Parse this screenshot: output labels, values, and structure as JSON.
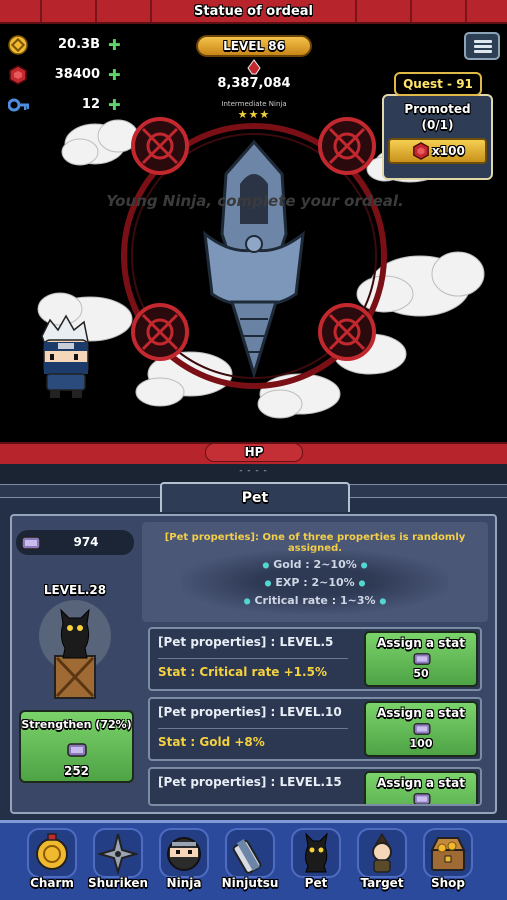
{
  "header": {
    "title": "Statue of ordeal"
  },
  "resources": [
    {
      "icon": "gold-coin-icon",
      "value": "20.3B"
    },
    {
      "icon": "red-gem-icon",
      "value": "38400"
    },
    {
      "icon": "key-icon",
      "value": "12"
    }
  ],
  "player": {
    "level": "LEVEL 86",
    "power": "8,387,084",
    "rank": "Intermediate Ninja",
    "stars": "★★★"
  },
  "quest": {
    "label": "Quest - 91",
    "name": "Promoted",
    "progress": "(0/1)",
    "reward": "x100"
  },
  "scene": {
    "message": "Young Ninja, complete your ordeal."
  },
  "hp": {
    "label": "HP",
    "value": "- - - -"
  },
  "pet_tab": {
    "label": "Pet"
  },
  "pet": {
    "feed_count": "974",
    "level": "LEVEL.28",
    "strengthen_label": "Strengthen (72%)",
    "strengthen_cost": "252",
    "strengthen_progress": 0.72
  },
  "properties_info": {
    "header": "[Pet properties]: One of three properties is randomly assigned.",
    "chances": [
      "Gold : 2~10%",
      "EXP : 2~10%",
      "Critical rate : 1~3%"
    ]
  },
  "property_rows": [
    {
      "title": "[Pet properties] : LEVEL.5",
      "stat": "Stat : Critical rate +1.5%",
      "button": "Assign a stat",
      "cost": "50"
    },
    {
      "title": "[Pet properties] : LEVEL.10",
      "stat": "Stat : Gold +8%",
      "button": "Assign a stat",
      "cost": "100"
    },
    {
      "title": "[Pet properties] : LEVEL.15",
      "stat": "",
      "button": "Assign a stat",
      "cost": ""
    }
  ],
  "nav": [
    {
      "label": "Charm",
      "icon": "charm-icon"
    },
    {
      "label": "Shuriken",
      "icon": "shuriken-icon"
    },
    {
      "label": "Ninja",
      "icon": "ninja-icon"
    },
    {
      "label": "Ninjutsu",
      "icon": "scroll-icon"
    },
    {
      "label": "Pet",
      "icon": "cat-icon"
    },
    {
      "label": "Target",
      "icon": "target-icon"
    },
    {
      "label": "Shop",
      "icon": "chest-icon"
    }
  ],
  "colors": {
    "accent_red": "#b8242c",
    "panel": "#3a4766",
    "button_green": "#5fbf55",
    "gold": "#f4d23f",
    "nav_blue": "#2b4a9c"
  }
}
